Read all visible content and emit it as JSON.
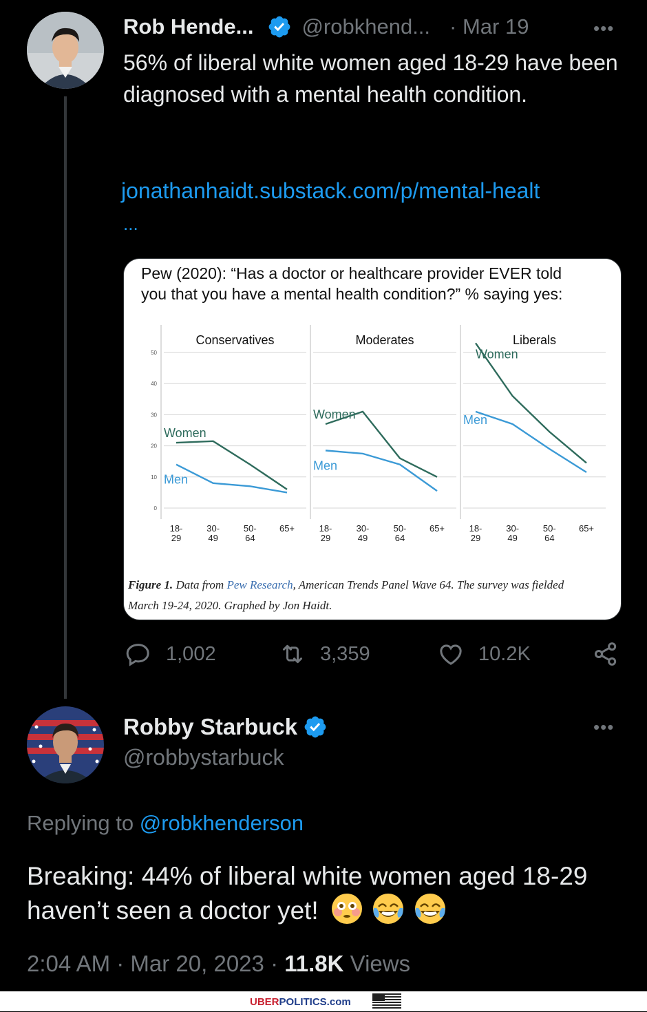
{
  "original_tweet": {
    "author_name": "Rob Hende...",
    "handle": "@robkhend...",
    "date": "· Mar 19",
    "more": "•••",
    "text": "56% of liberal white women aged 18-29 have been diagnosed with a mental health condition.",
    "link": "jonathanhaidt.substack.com/p/mental-healt",
    "link_ellipsis": "...",
    "actions": {
      "replies": "1,002",
      "retweets": "3,359",
      "likes": "10.2K"
    }
  },
  "reply_tweet": {
    "author_name": "Robby Starbuck",
    "handle": "@robbystarbuck",
    "more": "•••",
    "replying_to_prefix": "Replying to ",
    "replying_to_handle": "@robkhenderson",
    "text": "Breaking: 44% of liberal white women aged 18-29 haven’t seen a doctor yet!",
    "emojis": [
      "flushed-face",
      "face-with-tears-of-joy",
      "face-with-tears-of-joy"
    ],
    "time": "2:04 AM",
    "date": "Mar 20, 2023",
    "views_count": "11.8K",
    "views_label": "Views"
  },
  "figure": {
    "title_line1": "Pew (2020): “Has a doctor or healthcare provider EVER told",
    "title_line2": "you that you have a mental health condition?” % saying yes:",
    "caption_figure": "Figure 1.",
    "caption_text1": "Data from ",
    "caption_link": "Pew Research",
    "caption_text2": ", American Trends Panel Wave 64. The survey was fielded",
    "caption_line2": "March 19-24, 2020. Graphed by Jon Haidt."
  },
  "chart_data": {
    "type": "line",
    "y_ticks": [
      "50",
      "40",
      "30",
      "20",
      "10",
      "0"
    ],
    "ylim": [
      0,
      50
    ],
    "categories": [
      "18-29",
      "30-49",
      "50-64",
      "65+"
    ],
    "category_top": [
      "18-",
      "30-",
      "50-",
      "65+"
    ],
    "category_bottom": [
      "29",
      "49",
      "64",
      ""
    ],
    "panels": [
      {
        "title": "Conservatives",
        "series": [
          {
            "name": "Women",
            "values": [
              21,
              21.5,
              14,
              6
            ]
          },
          {
            "name": "Men",
            "values": [
              14,
              8,
              7,
              5
            ]
          }
        ]
      },
      {
        "title": "Moderates",
        "series": [
          {
            "name": "Women",
            "values": [
              27,
              31,
              16,
              10
            ]
          },
          {
            "name": "Men",
            "values": [
              18.5,
              17.5,
              14,
              5.5
            ]
          }
        ]
      },
      {
        "title": "Liberals",
        "series": [
          {
            "name": "Women",
            "values": [
              53,
              36,
              24.5,
              14.5
            ]
          },
          {
            "name": "Men",
            "values": [
              31,
              27,
              19,
              11.5
            ]
          }
        ]
      }
    ],
    "colors": {
      "women": "#2e6b5c",
      "men": "#3b9ad6",
      "grid": "#d6d6d6"
    }
  },
  "watermark": {
    "brand_part1": "UBER",
    "brand_part2": "POLITICS.com"
  },
  "colors": {
    "accent": "#1d9bf0",
    "muted": "#71767b",
    "background": "#000000",
    "text": "#e7e9ea"
  }
}
